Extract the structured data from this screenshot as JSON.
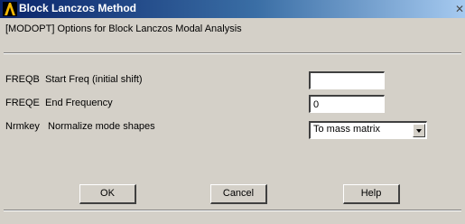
{
  "window": {
    "title": "Block Lanczos Method",
    "title_icon": "ansys-logo-icon",
    "close_glyph": "✕"
  },
  "header": {
    "subtitle": "[MODOPT]  Options for Block Lanczos Modal Analysis"
  },
  "fields": {
    "freqb": {
      "label": "FREQB  Start Freq (initial shift)",
      "value": ""
    },
    "freqe": {
      "label": "FREQE  End Frequency",
      "value": "0"
    },
    "nrmkey": {
      "label": "Nrmkey   Normalize mode shapes",
      "selected": "To mass matrix"
    }
  },
  "buttons": {
    "ok": "OK",
    "cancel": "Cancel",
    "help": "Help"
  },
  "colors": {
    "title_bar_start": "#0a246a",
    "title_bar_end": "#a6caf0",
    "dialog_background": "#d4d0c8"
  }
}
